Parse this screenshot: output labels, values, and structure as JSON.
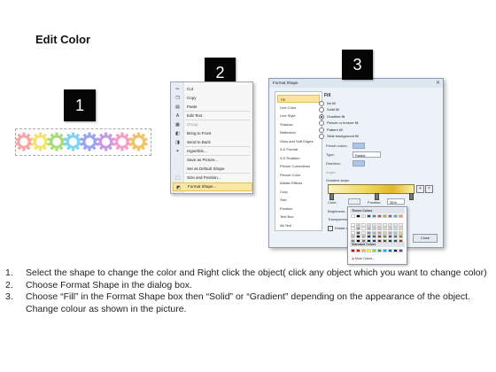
{
  "title": "Edit Color",
  "badges": {
    "one": "1",
    "two": "2",
    "three": "3"
  },
  "gears": {
    "colors": [
      "#f7a6a6",
      "#f6e36e",
      "#a8dd7a",
      "#7fd4f2",
      "#9aa4f0",
      "#c79ae6",
      "#f59fc8",
      "#f6c065"
    ]
  },
  "context_menu": {
    "items": [
      {
        "label": "Cut",
        "icon": "scissors-icon",
        "glyph": "✂",
        "enabled": true
      },
      {
        "label": "Copy",
        "icon": "copy-icon",
        "glyph": "❐",
        "enabled": true
      },
      {
        "label": "Paste",
        "icon": "paste-icon",
        "glyph": "▤",
        "enabled": true
      },
      {
        "label": "Edit Text",
        "icon": "edit-text-icon",
        "glyph": "A",
        "enabled": true
      },
      {
        "label": "Group",
        "icon": "group-icon",
        "glyph": "▦",
        "enabled": false
      },
      {
        "label": "Bring to Front",
        "icon": "bring-front-icon",
        "glyph": "◧",
        "enabled": true
      },
      {
        "label": "Send to Back",
        "icon": "send-back-icon",
        "glyph": "◨",
        "enabled": true
      },
      {
        "label": "Hyperlink...",
        "icon": "hyperlink-icon",
        "glyph": "⚭",
        "enabled": true
      },
      {
        "label": "Save as Picture...",
        "icon": "",
        "glyph": "",
        "enabled": true
      },
      {
        "label": "Set as Default Shape",
        "icon": "",
        "glyph": "",
        "enabled": true
      },
      {
        "label": "Size and Position...",
        "icon": "size-position-icon",
        "glyph": "⬚",
        "enabled": true
      },
      {
        "label": "Format Shape...",
        "icon": "format-shape-icon",
        "glyph": "◩",
        "enabled": true,
        "highlighted": true
      }
    ]
  },
  "dialog": {
    "title": "Format Shape",
    "close_glyph": "✕",
    "nav": [
      "Fill",
      "Line Color",
      "Line Style",
      "Shadow",
      "Reflection",
      "Glow and Soft Edges",
      "3-D Format",
      "3-D Rotation",
      "Picture Corrections",
      "Picture Color",
      "Artistic Effects",
      "Crop",
      "Size",
      "Position",
      "Text Box",
      "Alt Text"
    ],
    "nav_selected": "Fill",
    "section": "Fill",
    "fill_options": [
      {
        "label": "No fill",
        "checked": false
      },
      {
        "label": "Solid fill",
        "checked": false
      },
      {
        "label": "Gradient fill",
        "checked": true
      },
      {
        "label": "Picture or texture fill",
        "checked": false
      },
      {
        "label": "Pattern fill",
        "checked": false
      },
      {
        "label": "Slide background fill",
        "checked": false
      }
    ],
    "preset_colors_label": "Preset colors:",
    "type_label": "Type:",
    "type_value": "Radial",
    "direction_label": "Direction:",
    "angle_label": "Angle:",
    "gradient_stops_label": "Gradient stops",
    "color_label": "Color:",
    "position_label": "Position:",
    "position_value": "36%",
    "brightness_label": "Brightness:",
    "transparency_label": "Transparency:",
    "rotate_label": "Rotate with shape",
    "close_label": "Close"
  },
  "palette": {
    "theme_colors_label": "Theme Colors",
    "standard_colors_label": "Standard Colors",
    "more_colors_label": "More Colors...",
    "theme_top": [
      "#ffffff",
      "#000000",
      "#eeece1",
      "#1f497d",
      "#4f81bd",
      "#c0504d",
      "#9bbb59",
      "#8064a2",
      "#4bacc6",
      "#f79646"
    ],
    "standard": [
      "#c00000",
      "#ff0000",
      "#ffc000",
      "#ffff00",
      "#92d050",
      "#00b050",
      "#00b0f0",
      "#0070c0",
      "#002060",
      "#7030a0"
    ]
  },
  "steps": [
    {
      "num": "1.",
      "text": "Select the shape to change the color and Right click the object( click any object which you want to change color)"
    },
    {
      "num": "2.",
      "text": "Choose Format Shape in the dialog box."
    },
    {
      "num": "3.",
      "text": "Choose “Fill” in the Format Shape box then “Solid” or “Gradient” depending on the appearance of the object. Change colour as shown in the picture."
    }
  ]
}
